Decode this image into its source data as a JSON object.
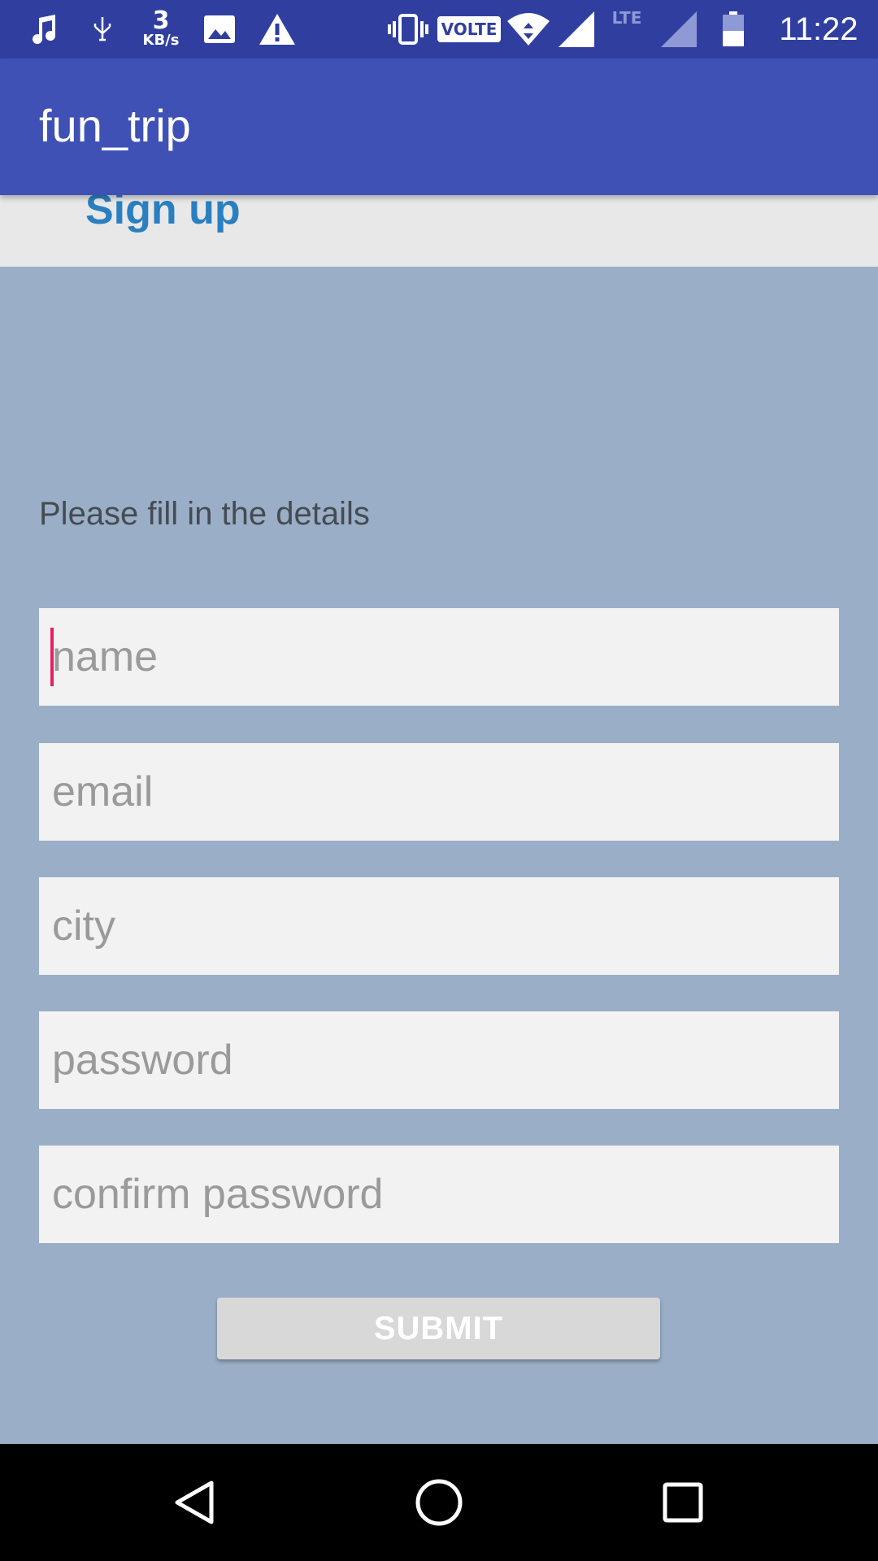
{
  "status_bar": {
    "network_speed_value": "3",
    "network_speed_unit": "KB/s",
    "volte_label": "VOLTE",
    "lte_label": "LTE",
    "time": "11:22",
    "icons": [
      "music-note-icon",
      "usb-icon",
      "image-icon",
      "warning-icon",
      "vibrate-icon",
      "volte-icon",
      "wifi-icon",
      "signal-icon",
      "lte-signal-icon",
      "battery-icon"
    ]
  },
  "app_bar": {
    "title": "fun_trip"
  },
  "header": {
    "signup_label": "Sign up"
  },
  "form": {
    "instructions": "Please fill in the details",
    "fields": [
      {
        "placeholder": "name",
        "value": ""
      },
      {
        "placeholder": "email",
        "value": ""
      },
      {
        "placeholder": "city",
        "value": ""
      },
      {
        "placeholder": "password",
        "value": ""
      },
      {
        "placeholder": "confirm password",
        "value": ""
      }
    ],
    "submit_label": "SUBMIT"
  },
  "colors": {
    "status_bar": "#303f9f",
    "app_bar": "#3f51b5",
    "content_bg": "#9aafc7",
    "signup_text": "#2a7fc0",
    "caret": "#e91e63"
  },
  "nav_bar": {
    "icons": [
      "back-icon",
      "home-icon",
      "recents-icon"
    ]
  }
}
